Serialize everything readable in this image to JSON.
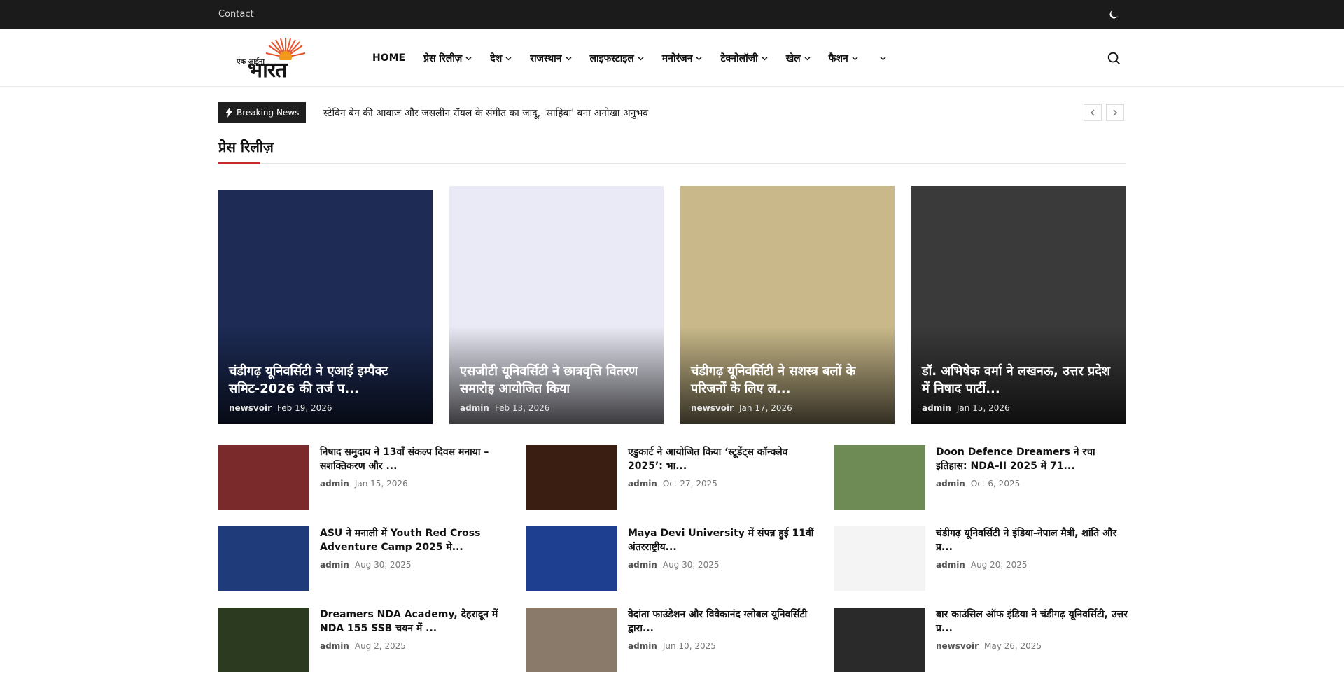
{
  "topbar": {
    "contact": "Contact"
  },
  "logo": {
    "small": "एक आईना",
    "big": "भारत"
  },
  "nav": {
    "items": [
      {
        "label": "HOME",
        "dropdown": false
      },
      {
        "label": "प्रेस रिलीज़",
        "dropdown": true
      },
      {
        "label": "देश",
        "dropdown": true
      },
      {
        "label": "राजस्थान",
        "dropdown": true
      },
      {
        "label": "लाइफस्टाइल",
        "dropdown": true
      },
      {
        "label": "मनोरंजन",
        "dropdown": true
      },
      {
        "label": "टेक्नोलॉजी",
        "dropdown": true
      },
      {
        "label": "खेल",
        "dropdown": true
      },
      {
        "label": "फैशन",
        "dropdown": true
      },
      {
        "label": "",
        "dropdown": true
      }
    ]
  },
  "breaking": {
    "label": "Breaking News",
    "headline": "स्टेविन बेन की आवाज और जसलीन रॉयल के संगीत का जादू, 'साहिबा' बना अनोखा अनुभव"
  },
  "section": {
    "title": "प्रेस रिलीज़"
  },
  "cards": [
    {
      "title": "चंडीगढ़ यूनिवर्सिटी ने एआई इम्पैक्ट समिट-2026 की तर्ज प...",
      "author": "newsvoir",
      "date": "Feb 19, 2026",
      "bg": "#1d2b55"
    },
    {
      "title": "एसजीटी यूनिवर्सिटी ने छात्रवृत्ति वितरण समारोह आयोजित किया",
      "author": "admin",
      "date": "Feb 13, 2026",
      "bg": "#e9eaf5"
    },
    {
      "title": "चंडीगढ़ यूनिवर्सिटी ने सशस्त्र बलों के परिजनों के लिए ल...",
      "author": "newsvoir",
      "date": "Jan 17, 2026",
      "bg": "#c9b98a"
    },
    {
      "title": "डॉ. अभिषेक वर्मा ने लखनऊ, उत्तर प्रदेश में निषाद पार्टी...",
      "author": "admin",
      "date": "Jan 15, 2026",
      "bg": "#3b3a3a"
    }
  ],
  "list": [
    {
      "title": "निषाद समुदाय ने 13वाँ संकल्प दिवस मनाया – सशक्तिकरण और ...",
      "author": "admin",
      "date": "Jan 15, 2026",
      "bg": "#7a2a2a"
    },
    {
      "title": "एडुकार्ट ने आयोजित किया ‘स्टूडेंट्स कॉन्क्लेव 2025’: भा...",
      "author": "admin",
      "date": "Oct 27, 2025",
      "bg": "#3a1e12"
    },
    {
      "title": "Doon Defence Dreamers ने रचा इतिहास: NDA–II 2025 में 71...",
      "author": "admin",
      "date": "Oct 6, 2025",
      "bg": "#6e8a55"
    },
    {
      "title": "ASU ने मनाली में Youth Red Cross Adventure Camp 2025 मे...",
      "author": "admin",
      "date": "Aug 30, 2025",
      "bg": "#1f3b7a"
    },
    {
      "title": "Maya Devi University में संपन्न हुई 11वीं अंतरराष्ट्रीय...",
      "author": "admin",
      "date": "Aug 30, 2025",
      "bg": "#1e3f8f"
    },
    {
      "title": "चंडीगढ़ यूनिवर्सिटी ने इंडिया-नेपाल मैत्री, शांति और प्र...",
      "author": "admin",
      "date": "Aug 20, 2025",
      "bg": "#f4f4f4"
    },
    {
      "title": "Dreamers NDA Academy, देहरादून में NDA 155 SSB चयन में ...",
      "author": "admin",
      "date": "Aug 2, 2025",
      "bg": "#2c3a1f"
    },
    {
      "title": "वेदांता फाउंडेशन और विवेकानंद ग्लोबल यूनिवर्सिटी द्वारा...",
      "author": "admin",
      "date": "Jun 10, 2025",
      "bg": "#8a7a6a"
    },
    {
      "title": "बार काउंसिल ऑफ इंडिया ने चंडीगढ़ यूनिवर्सिटी, उत्तर प्र...",
      "author": "newsvoir",
      "date": "May 26, 2025",
      "bg": "#2a2a2a"
    }
  ],
  "colors": {
    "accent": "#c8282f",
    "topbar": "#1b1b1b"
  },
  "icons": {
    "theme": "moon-icon",
    "search": "search-icon",
    "breaking": "lightning-icon",
    "prev": "chevron-left-icon",
    "next": "chevron-right-icon"
  }
}
